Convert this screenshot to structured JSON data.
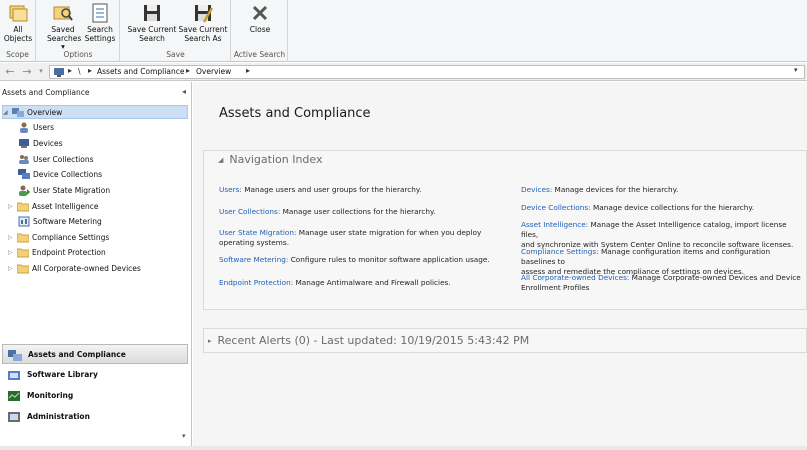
{
  "ribbon": {
    "groups": [
      {
        "label": "Scope"
      },
      {
        "label": "Options"
      },
      {
        "label": "Save"
      },
      {
        "label": "Active Search"
      }
    ],
    "buttons": {
      "all_objects": {
        "line1": "All",
        "line2": "Objects"
      },
      "saved_searches": {
        "line1": "Saved",
        "line2": "Searches ▾"
      },
      "search_settings": {
        "line1": "Search",
        "line2": "Settings"
      },
      "save_current_search": {
        "line1": "Save Current",
        "line2": "Search"
      },
      "save_current_search_as": {
        "line1": "Save Current",
        "line2": "Search As"
      },
      "close": {
        "line1": "Close"
      }
    }
  },
  "address_bar": {
    "breadcrumb": [
      "\\",
      "Assets and Compliance",
      "Overview"
    ]
  },
  "left_pane": {
    "title": "Assets and Compliance",
    "tree": [
      {
        "label": "Overview"
      },
      {
        "label": "Users"
      },
      {
        "label": "Devices"
      },
      {
        "label": "User Collections"
      },
      {
        "label": "Device Collections"
      },
      {
        "label": "User State Migration"
      },
      {
        "label": "Asset Intelligence"
      },
      {
        "label": "Software Metering"
      },
      {
        "label": "Compliance Settings"
      },
      {
        "label": "Endpoint Protection"
      },
      {
        "label": "All Corporate-owned Devices"
      }
    ],
    "workspaces": [
      {
        "label": "Assets and Compliance"
      },
      {
        "label": "Software Library"
      },
      {
        "label": "Monitoring"
      },
      {
        "label": "Administration"
      }
    ]
  },
  "main": {
    "title": "Assets and Compliance",
    "nav_index": {
      "title": "Navigation Index",
      "left": [
        {
          "link": "Users:",
          "text": " Manage users and user groups for the hierarchy."
        },
        {
          "link": "User Collections:",
          "text": " Manage user collections for the hierarchy."
        },
        {
          "link": "User State Migration:",
          "text": " Manage user state migration for when you deploy",
          "text2": "operating systems."
        },
        {
          "link": "Software Metering:",
          "text": " Configure rules to monitor software application usage."
        },
        {
          "link": "Endpoint Protection:",
          "text": " Manage Antimalware and Firewall policies."
        }
      ],
      "right": [
        {
          "link": "Devices:",
          "text": " Manage devices for the hierarchy."
        },
        {
          "link": "Device Collections:",
          "text": " Manage device collections for the hierarchy."
        },
        {
          "link": "Asset Intelligence:",
          "text": " Manage the Asset Intelligence catalog, import license files,",
          "text2": "and synchronize with System Center Online to reconcile software licenses."
        },
        {
          "link": "Compliance Settings:",
          "text": " Manage configuration items and configuration baselines to",
          "text2": "assess and remediate the compliance of settings on devices."
        },
        {
          "link": "All Corporate-owned Devices:",
          "text": " Manage Corporate-owned Devices and Device",
          "text2": "Enrollment Profiles"
        }
      ]
    },
    "recent_alerts": {
      "title": "Recent Alerts (0) - Last updated: 10/19/2015 5:43:42 PM"
    }
  }
}
